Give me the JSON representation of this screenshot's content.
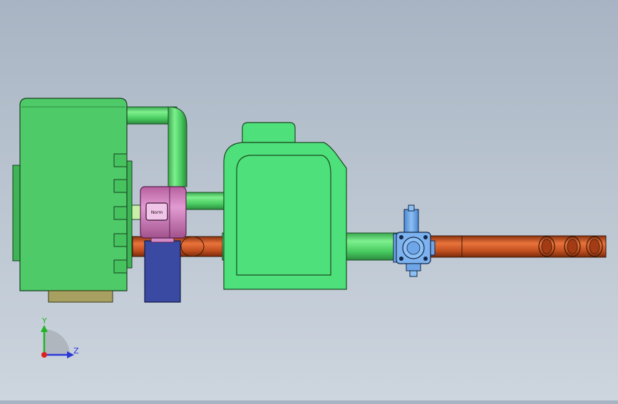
{
  "viewport": {
    "background_top": "#a8b4c3",
    "background_bottom": "#cdd5de"
  },
  "model": {
    "components": [
      {
        "name": "engine-block",
        "color": "#4ecb68"
      },
      {
        "name": "upper-green-pipe",
        "color": "#4ecb68"
      },
      {
        "name": "pink-pump-housing",
        "color": "#d47fc1"
      },
      {
        "name": "blue-mount-block",
        "color": "#3a4aa3"
      },
      {
        "name": "green-tank",
        "color": "#4ee07a"
      },
      {
        "name": "blue-valve-assembly",
        "color": "#6fa6e8"
      },
      {
        "name": "orange-exhaust-pipe",
        "color": "#c8501e"
      }
    ],
    "nameplate_text": "Norm"
  },
  "triad": {
    "y_label": "Y",
    "z_label": "Z",
    "y_color": "#22b422",
    "z_color": "#2a36d8",
    "origin_color": "#e02020"
  }
}
